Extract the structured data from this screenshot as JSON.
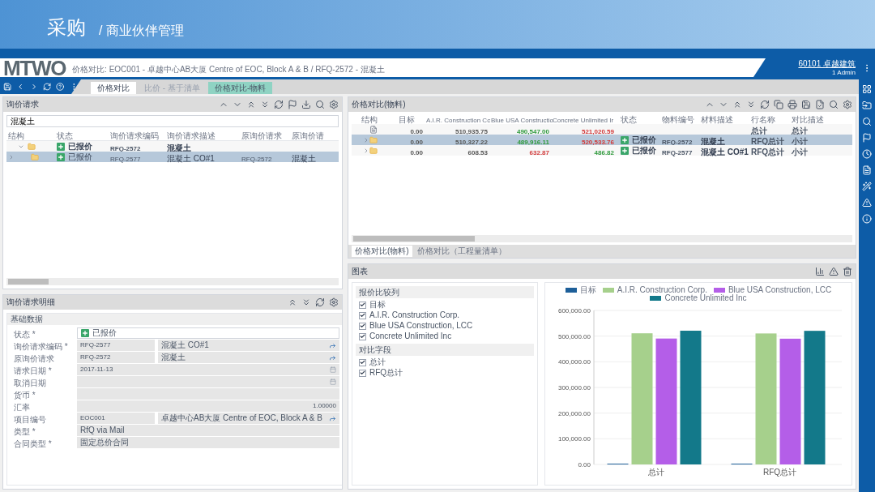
{
  "header": {
    "title": "采购",
    "breadcrumb": "/ 商业伙伴管理"
  },
  "appbar": {
    "logo": "MTWO",
    "context": "价格对比: EOC001 - 卓越中心AB大厦 Centre of EOC, Block A & B / RFQ-2572 - 混凝土",
    "company": "60101 卓越建筑",
    "user": "1 Admin"
  },
  "tabs": [
    {
      "label": "价格对比",
      "selected": true,
      "kind": "normal"
    },
    {
      "label": "比价 - 基于清单",
      "selected": false,
      "kind": "disabled"
    },
    {
      "label": "价格对比-物料",
      "selected": false,
      "kind": "accent"
    }
  ],
  "rfq_panel": {
    "title": "询价请求",
    "search": "混凝土",
    "columns": [
      "结构",
      "状态",
      "询价请求编码",
      "询价请求描述",
      "原询价请求",
      "原询价请"
    ],
    "rows": [
      {
        "selected": false,
        "bold": true,
        "expanded": true,
        "status": "已报价",
        "code": "RFQ-2572",
        "desc": "混凝土"
      },
      {
        "selected": true,
        "bold": false,
        "expanded": false,
        "status": "已报价",
        "code": "RFQ-2577",
        "desc": "混凝土 CO#1",
        "orig_code": "RFQ-2572",
        "orig_desc": "混凝土"
      }
    ]
  },
  "compare_panel": {
    "title": "价格对比(物料)",
    "columns": [
      "结构",
      "目标",
      "A.I.R. Construction Cc",
      "Blue USA Constructio",
      "Concrete Unlimited Ir",
      "状态",
      "物料编号",
      "材料描述",
      "行名称",
      "对比描述"
    ],
    "rows": [
      {
        "selected": false,
        "kind": "total",
        "values": [
          {
            "text": "0.00",
            "color": "#555555"
          },
          {
            "text": "510,935.75",
            "color": "#555555"
          },
          {
            "text": "490,547.00",
            "color": "#2f9a3c"
          },
          {
            "text": "521,020.59",
            "color": "#d23a3a"
          }
        ],
        "line": "总计",
        "compare": "总计"
      },
      {
        "selected": true,
        "kind": "folder",
        "values": [
          {
            "text": "0.00",
            "color": "#555555"
          },
          {
            "text": "510,327.22",
            "color": "#555555"
          },
          {
            "text": "489,916.11",
            "color": "#2f9a3c"
          },
          {
            "text": "520,533.76",
            "color": "#d23a3a"
          }
        ],
        "status": "已报价",
        "material": "RFQ-2572",
        "material_desc": "混凝土",
        "line": "RFQ总计",
        "compare": "小计"
      },
      {
        "selected": false,
        "kind": "folder",
        "values": [
          {
            "text": "0.00",
            "color": "#555555"
          },
          {
            "text": "608.53",
            "color": "#555555"
          },
          {
            "text": "632.87",
            "color": "#d23a3a"
          },
          {
            "text": "486.82",
            "color": "#2f9a3c"
          }
        ],
        "status": "已报价",
        "material": "RFQ-2577",
        "material_desc": "混凝土 CO#1",
        "line": "RFQ总计",
        "compare": "小计"
      }
    ],
    "bottom_tabs": [
      {
        "label": "价格对比(物料)",
        "selected": true
      },
      {
        "label": "价格对比（工程量清单）",
        "selected": false
      }
    ]
  },
  "detail_panel": {
    "title": "询价请求明细",
    "section": "基础数据",
    "fields": [
      {
        "label": "状态 *",
        "kind": "status",
        "value": "已报价"
      },
      {
        "label": "询价请求编码 *",
        "kind": "pair",
        "value": "RFQ-2577",
        "value2": "混凝土 CO#1"
      },
      {
        "label": "原询价请求",
        "kind": "pair",
        "value": "RFQ-2572",
        "value2": "混凝土"
      },
      {
        "label": "请求日期 *",
        "kind": "date",
        "value": "2017-11-13"
      },
      {
        "label": "取消日期",
        "kind": "date"
      },
      {
        "label": "货币 *",
        "kind": "text"
      },
      {
        "label": "汇率",
        "kind": "number",
        "value": "1.00000"
      },
      {
        "label": "项目编号",
        "kind": "pair",
        "value": "EOC001",
        "value2": "卓越中心AB大厦 Centre of EOC, Block A & B"
      },
      {
        "label": "类型 *",
        "kind": "text",
        "value": "RfQ via Mail"
      },
      {
        "label": "合同类型 *",
        "kind": "text",
        "value": "固定总价合同"
      }
    ]
  },
  "chart_panel": {
    "title": "图表",
    "filters": [
      {
        "title": "报价比较列",
        "items": [
          {
            "label": "目标",
            "checked": true
          },
          {
            "label": "A.I.R. Construction Corp.",
            "checked": true
          },
          {
            "label": "Blue USA Construction, LCC",
            "checked": true
          },
          {
            "label": "Concrete Unlimited Inc",
            "checked": true
          }
        ]
      },
      {
        "title": "对比字段",
        "items": [
          {
            "label": "总计",
            "checked": true
          },
          {
            "label": "RFQ总计",
            "checked": true
          }
        ]
      }
    ],
    "chart_data": {
      "type": "bar",
      "categories": [
        "总计",
        "RFQ总计"
      ],
      "series": [
        {
          "name": "目标",
          "color": "#1d5f99",
          "values": [
            0,
            0
          ]
        },
        {
          "name": "A.I.R. Construction Corp.",
          "color": "#a6d08c",
          "values": [
            510935.75,
            510327.22
          ]
        },
        {
          "name": "Blue USA Construction, LCC",
          "color": "#b45ee8",
          "values": [
            490547,
            489916.11
          ]
        },
        {
          "name": "Concrete Unlimited Inc",
          "color": "#13798a",
          "values": [
            521020.59,
            520533.76
          ]
        }
      ],
      "ylim": [
        0,
        600000
      ],
      "grid": true,
      "legend": true,
      "yticks": [
        {
          "value": 0,
          "label": "0.00"
        },
        {
          "value": 100000,
          "label": "100,000.00"
        },
        {
          "value": 200000,
          "label": "200,000.00"
        },
        {
          "value": 300000,
          "label": "300,000.00"
        },
        {
          "value": 400000,
          "label": "400,000.00"
        },
        {
          "value": 500000,
          "label": "500,000.00"
        },
        {
          "value": 600000,
          "label": "600,000.00"
        }
      ]
    }
  }
}
